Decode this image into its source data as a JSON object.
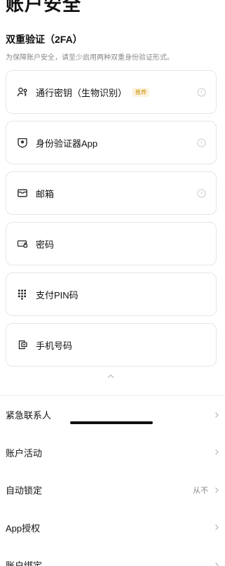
{
  "page": {
    "title": "账户安全"
  },
  "twofa": {
    "title": "双重验证（2FA）",
    "description": "为保障账户安全，请至少启用两种双重身份验证形式。",
    "methods": [
      {
        "label": "通行密钥（生物识别）",
        "badge": "推荐",
        "icon": "passkey-icon",
        "has_info": true
      },
      {
        "label": "身份验证器App",
        "badge": "",
        "icon": "authenticator-icon",
        "has_info": true
      },
      {
        "label": "邮箱",
        "badge": "",
        "icon": "mail-icon",
        "has_info": true
      },
      {
        "label": "密码",
        "badge": "",
        "icon": "password-icon",
        "has_info": false
      },
      {
        "label": "支付PIN码",
        "badge": "",
        "icon": "pin-keypad-icon",
        "has_info": false
      },
      {
        "label": "手机号码",
        "badge": "",
        "icon": "phone-icon",
        "has_info": false
      }
    ]
  },
  "settings": [
    {
      "label": "紧急联系人",
      "value": ""
    },
    {
      "label": "账户活动",
      "value": ""
    },
    {
      "label": "自动锁定",
      "value": "从不"
    },
    {
      "label": "App授权",
      "value": ""
    },
    {
      "label": "账户绑定",
      "value": ""
    }
  ],
  "colors": {
    "badge_text": "#c9900a",
    "badge_bg": "#fdf3df",
    "muted": "#8a8a8a"
  }
}
